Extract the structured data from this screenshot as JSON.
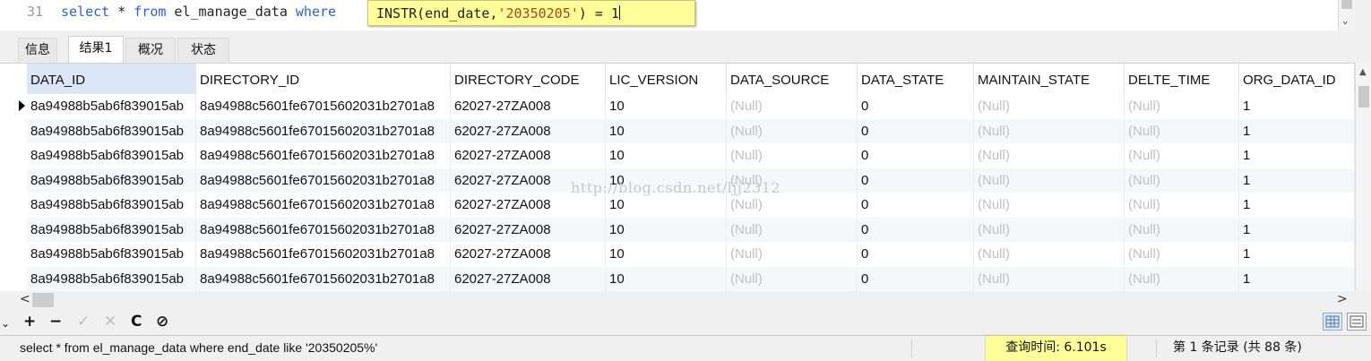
{
  "editor": {
    "line_number": "31",
    "kw_select": "select",
    "star": " * ",
    "kw_from": "from",
    "table": " el_manage_data ",
    "kw_where": "where",
    "tooltip_fn": "INSTR(end_date,",
    "tooltip_str": "'20350205'",
    "tooltip_tail": ") = 1"
  },
  "tabs": [
    "信息",
    "结果1",
    "概况",
    "状态"
  ],
  "active_tab": "结果1",
  "grid": {
    "columns": [
      "DATA_ID",
      "DIRECTORY_ID",
      "DIRECTORY_CODE",
      "LIC_VERSION",
      "DATA_SOURCE",
      "DATA_STATE",
      "MAINTAIN_STATE",
      "DELTE_TIME",
      "ORG_DATA_ID"
    ],
    "rows": [
      [
        "8a94988b5ab6f839015ab",
        "8a94988c5601fe67015602031b2701a8",
        "62027-27ZA008",
        "10",
        "(Null)",
        "0",
        "(Null)",
        "(Null)",
        "1"
      ],
      [
        "8a94988b5ab6f839015ab",
        "8a94988c5601fe67015602031b2701a8",
        "62027-27ZA008",
        "10",
        "(Null)",
        "0",
        "(Null)",
        "(Null)",
        "1"
      ],
      [
        "8a94988b5ab6f839015ab",
        "8a94988c5601fe67015602031b2701a8",
        "62027-27ZA008",
        "10",
        "(Null)",
        "0",
        "(Null)",
        "(Null)",
        "1"
      ],
      [
        "8a94988b5ab6f839015ab",
        "8a94988c5601fe67015602031b2701a8",
        "62027-27ZA008",
        "10",
        "(Null)",
        "0",
        "(Null)",
        "(Null)",
        "1"
      ],
      [
        "8a94988b5ab6f839015ab",
        "8a94988c5601fe67015602031b2701a8",
        "62027-27ZA008",
        "10",
        "(Null)",
        "0",
        "(Null)",
        "(Null)",
        "1"
      ],
      [
        "8a94988b5ab6f839015ab",
        "8a94988c5601fe67015602031b2701a8",
        "62027-27ZA008",
        "10",
        "(Null)",
        "0",
        "(Null)",
        "(Null)",
        "1"
      ],
      [
        "8a94988b5ab6f839015ab",
        "8a94988c5601fe67015602031b2701a8",
        "62027-27ZA008",
        "10",
        "(Null)",
        "0",
        "(Null)",
        "(Null)",
        "1"
      ],
      [
        "8a94988b5ab6f839015ab",
        "8a94988c5601fe67015602031b2701a8",
        "62027-27ZA008",
        "10",
        "(Null)",
        "0",
        "(Null)",
        "(Null)",
        "1"
      ]
    ],
    "null_color": "#c0c0c0",
    "selected_header_color": "#dbe7f6"
  },
  "watermark": "http://blog.csdn.net/ljj2312",
  "toolbar": {
    "add": "+",
    "delete": "−",
    "apply": "✓",
    "cancel": "✕",
    "refresh": "C",
    "stop": "⊘",
    "icons": [
      "plus-icon",
      "minus-icon",
      "check-icon",
      "cross-icon",
      "refresh-icon",
      "stop-icon",
      "grid-view-icon",
      "form-view-icon"
    ]
  },
  "status": {
    "sql": "select * from el_manage_data where end_date like '20350205%'",
    "query_time": "查询时间: 6.101s",
    "record_info": "第 1 条记录 (共 88 条)",
    "highlight_color": "#ffff99"
  }
}
